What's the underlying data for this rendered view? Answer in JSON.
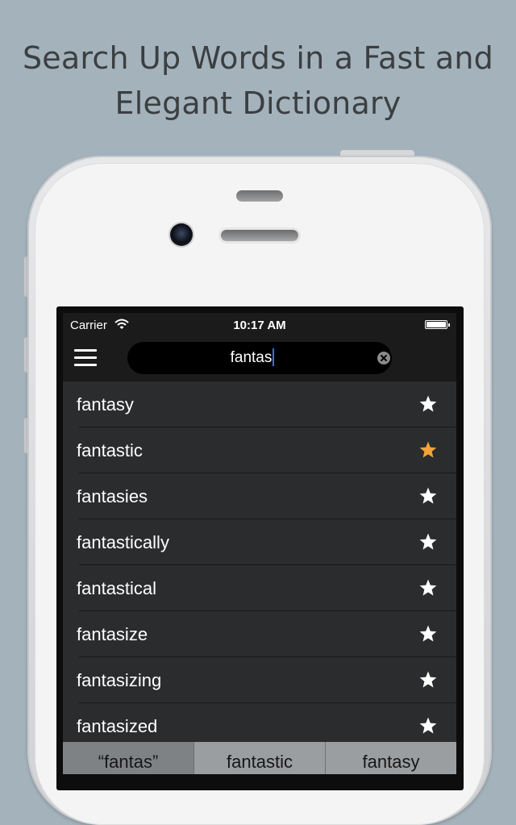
{
  "headline": {
    "line1": "Search Up Words in a Fast and",
    "line2": "Elegant Dictionary"
  },
  "status_bar": {
    "carrier": "Carrier",
    "time": "10:17 AM",
    "icons": [
      "wifi-icon",
      "battery-icon"
    ]
  },
  "search": {
    "value": "fantas"
  },
  "results": [
    {
      "word": "fantasy",
      "favorite": false
    },
    {
      "word": "fantastic",
      "favorite": true
    },
    {
      "word": "fantasies",
      "favorite": false
    },
    {
      "word": "fantastically",
      "favorite": false
    },
    {
      "word": "fantastical",
      "favorite": false
    },
    {
      "word": "fantasize",
      "favorite": false
    },
    {
      "word": "fantasizing",
      "favorite": false
    },
    {
      "word": "fantasized",
      "favorite": false
    }
  ],
  "suggestions": [
    "“fantas”",
    "fantastic",
    "fantasy"
  ],
  "colors": {
    "background": "#a4b2bb",
    "star_favorite": "#f3a33a",
    "star_default": "#ffffff",
    "cursor": "#3d6cf0"
  }
}
